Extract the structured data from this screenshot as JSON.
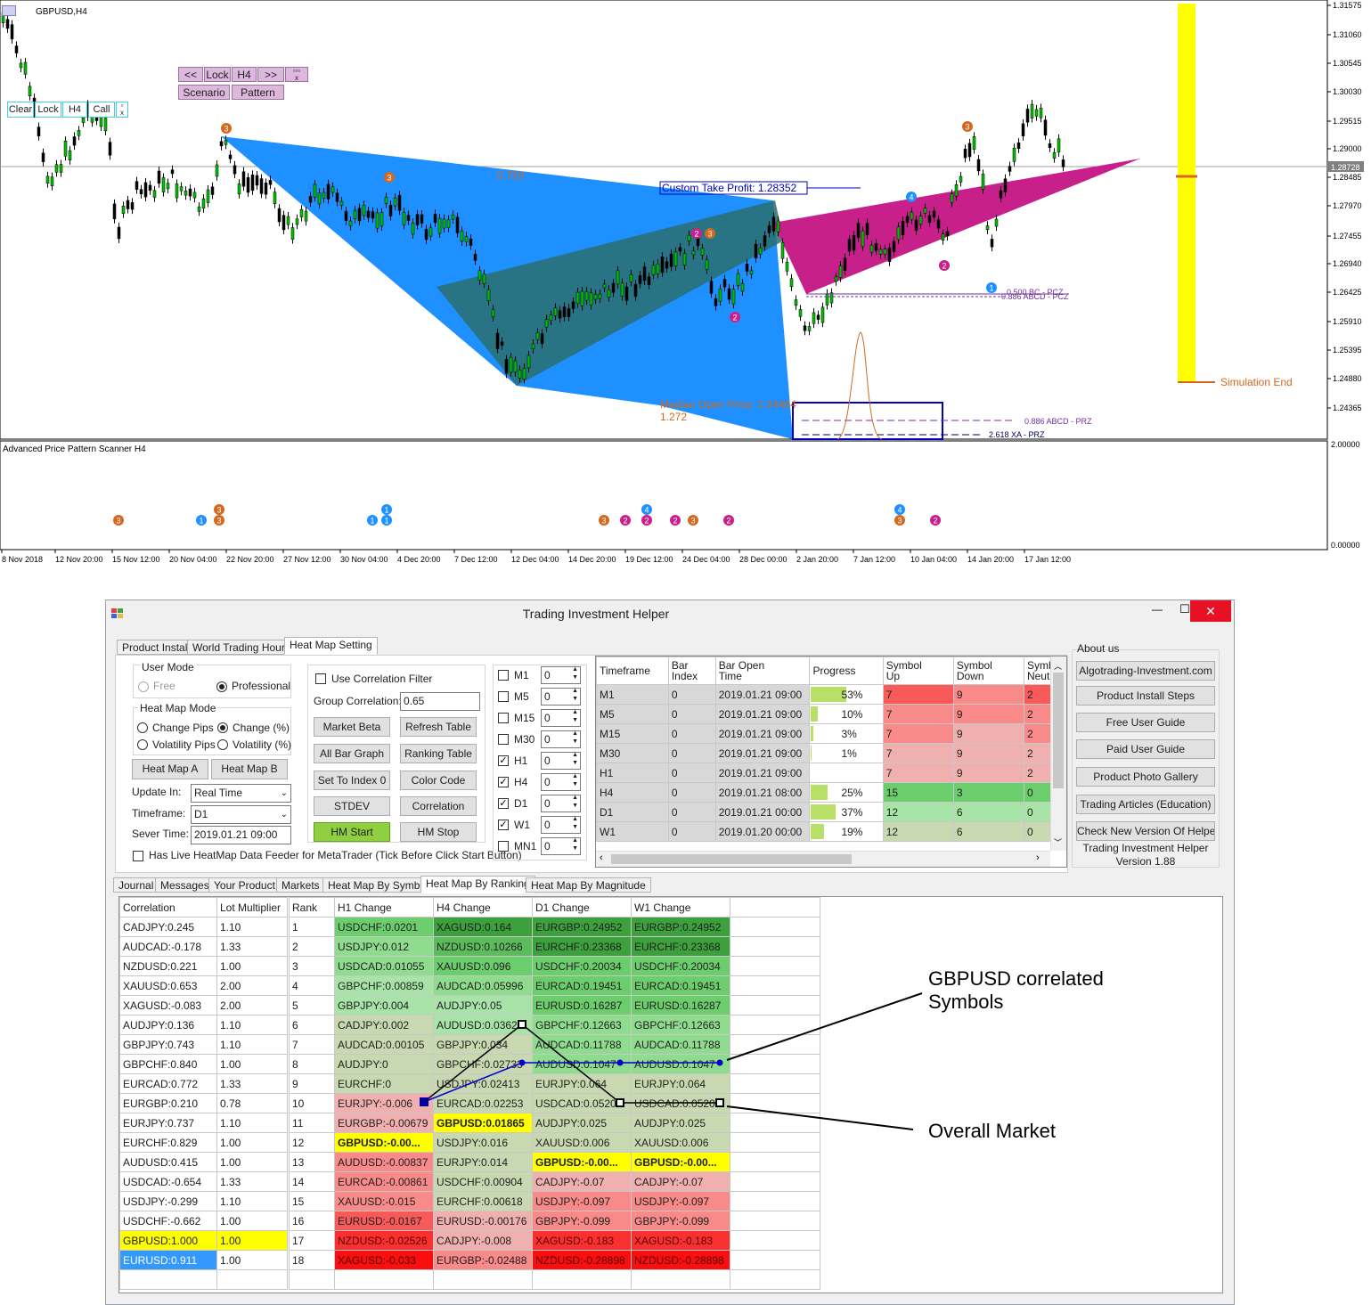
{
  "chart": {
    "symbol_title": "GBPUSD,H4",
    "indicator_title": "Advanced Price Pattern Scanner H4",
    "price_labels": [
      "1.31575",
      "1.31060",
      "1.30545",
      "1.30030",
      "1.29515",
      "1.29000",
      "1.28728",
      "1.28485",
      "1.27970",
      "1.27455",
      "1.26940",
      "1.26425",
      "1.25910",
      "1.25395",
      "1.24880",
      "1.24365"
    ],
    "current_price": "1.28728",
    "indicator_scale": [
      "2.00000",
      "0.00000"
    ],
    "date_labels": [
      "8 Nov 2018",
      "12 Nov 20:00",
      "15 Nov 12:00",
      "20 Nov 04:00",
      "22 Nov 20:00",
      "27 Nov 12:00",
      "30 Nov 04:00",
      "4 Dec 20:00",
      "7 Dec 12:00",
      "12 Dec 04:00",
      "14 Dec 20:00",
      "19 Dec 12:00",
      "24 Dec 04:00",
      "28 Dec 00:00",
      "2 Jan 20:00",
      "7 Jan 12:00",
      "10 Jan 04:00",
      "14 Jan 20:00",
      "17 Jan 12:00"
    ],
    "annotations": {
      "ratio_top": "0.750",
      "custom_tp": "Custom Take Profit: 1.28352",
      "median_open": "Median Open Price: 1.24404",
      "ratio_bottom": "1.272",
      "prz_1": "0.500 BC - PCZ",
      "prz_1b": "0.886 ABCD - PCZ",
      "prz_2": "0.886 ABCD - PRZ",
      "prz_3": "2.618 XA - PRZ",
      "simulation_end": "Simulation End"
    },
    "toolbar1": {
      "prev": "<<",
      "lock": "Lock",
      "tf": "H4",
      "next": ">>",
      "scenario": "Scenario",
      "pattern": "Pattern"
    },
    "toolbar2": {
      "clear": "Clear",
      "lock": "Lock",
      "tf": "H4",
      "call": "Call"
    },
    "colors": {
      "bull_harmonic": "#1e90ff",
      "bear_harmonic": "#c8208a",
      "teal_overlap": "#2a7f7f",
      "simulation_bar": "#ffff00",
      "orange_marker": "#d2691e"
    }
  },
  "window": {
    "title": "Trading Investment Helper",
    "min_glyph": "—",
    "max_glyph": "☐",
    "close_glyph": "✕",
    "top_tabs": [
      "Product Install",
      "World Trading Hours",
      "Heat Map Setting"
    ],
    "user_mode": {
      "title": "User Mode",
      "free": "Free",
      "professional": "Professional"
    },
    "heat_map_mode": {
      "title": "Heat Map Mode",
      "change_pips": "Change Pips",
      "change_pct": "Change (%)",
      "vol_pips": "Volatility Pips",
      "vol_pct": "Volatility (%)"
    },
    "buttons_left": {
      "heat_map_a": "Heat Map A",
      "heat_map_b": "Heat Map B"
    },
    "update_in": {
      "label": "Update In:",
      "value": "Real Time"
    },
    "timeframe": {
      "label": "Timeframe:",
      "value": "D1"
    },
    "server_time": {
      "label": "Sever Time:",
      "value": "2019.01.21 09:00"
    },
    "live_feeder": "Has Live HeatMap Data Feeder for MetaTrader (Tick Before Click Start Button)",
    "correlation": {
      "filter_label": "Use Correlation Filter",
      "group_label": "Group Correlation:",
      "group_value": "0.65"
    },
    "mid_buttons": [
      "Market Beta",
      "Refresh Table",
      "All Bar Graph",
      "Ranking Table",
      "Set To Index 0",
      "Color Code",
      "STDEV",
      "Correlation",
      "HM Start",
      "HM Stop"
    ],
    "timeframes": [
      {
        "name": "M1",
        "checked": false,
        "value": "0"
      },
      {
        "name": "M5",
        "checked": false,
        "value": "0"
      },
      {
        "name": "M15",
        "checked": false,
        "value": "0"
      },
      {
        "name": "M30",
        "checked": false,
        "value": "0"
      },
      {
        "name": "H1",
        "checked": true,
        "value": "0"
      },
      {
        "name": "H4",
        "checked": true,
        "value": "0"
      },
      {
        "name": "D1",
        "checked": true,
        "value": "0"
      },
      {
        "name": "W1",
        "checked": true,
        "value": "0"
      },
      {
        "name": "MN1",
        "checked": false,
        "value": "0"
      }
    ],
    "tf_table": {
      "headers": [
        "Timeframe",
        "Bar\nIndex",
        "Bar Open\nTime",
        "Progress",
        "Symbol\nUp",
        "Symbol\nDown",
        "Symbol\nNeutral"
      ],
      "rows": [
        {
          "tf": "M1",
          "idx": "0",
          "time": "2019.01.21 09:00",
          "progress": "53%",
          "up": "7",
          "down": "9",
          "neutral": "2"
        },
        {
          "tf": "M5",
          "idx": "0",
          "time": "2019.01.21 09:00",
          "progress": "10%",
          "up": "7",
          "down": "9",
          "neutral": "2"
        },
        {
          "tf": "M15",
          "idx": "0",
          "time": "2019.01.21 09:00",
          "progress": "3%",
          "up": "7",
          "down": "9",
          "neutral": "2"
        },
        {
          "tf": "M30",
          "idx": "0",
          "time": "2019.01.21 09:00",
          "progress": "1%",
          "up": "7",
          "down": "9",
          "neutral": "2"
        },
        {
          "tf": "H1",
          "idx": "0",
          "time": "2019.01.21 09:00",
          "progress": "",
          "up": "7",
          "down": "9",
          "neutral": "2"
        },
        {
          "tf": "H4",
          "idx": "0",
          "time": "2019.01.21 08:00",
          "progress": "25%",
          "up": "15",
          "down": "3",
          "neutral": "0"
        },
        {
          "tf": "D1",
          "idx": "0",
          "time": "2019.01.21 00:00",
          "progress": "37%",
          "up": "12",
          "down": "6",
          "neutral": "0"
        },
        {
          "tf": "W1",
          "idx": "0",
          "time": "2019.01.20 00:00",
          "progress": "19%",
          "up": "12",
          "down": "6",
          "neutral": "0"
        }
      ]
    },
    "about": {
      "title": "About us",
      "buttons": [
        "Algotrading-Investment.com",
        "Product Install Steps",
        "Free User Guide",
        "Paid User Guide",
        "Product Photo Gallery",
        "Trading Articles (Education)",
        "Check New Version Of Helper"
      ],
      "product": "Trading Investment Helper",
      "version": "Version 1.88"
    },
    "bottom_tabs": [
      "Journal",
      "Messages",
      "Your Product",
      "Markets",
      "Heat Map By Symbol",
      "Heat Map By Ranking",
      "Heat Map By Magnitude"
    ],
    "corr_table": {
      "headers": [
        "Correlation",
        "Lot Multiplier"
      ],
      "rows": [
        [
          "CADJPY:0.245",
          "1.10"
        ],
        [
          "AUDCAD:-0.178",
          "1.33"
        ],
        [
          "NZDUSD:0.221",
          "1.00"
        ],
        [
          "XAUUSD:0.653",
          "2.00"
        ],
        [
          "XAGUSD:-0.083",
          "2.00"
        ],
        [
          "AUDJPY:0.136",
          "1.10"
        ],
        [
          "GBPJPY:0.743",
          "1.10"
        ],
        [
          "GBPCHF:0.840",
          "1.00"
        ],
        [
          "EURCAD:0.772",
          "1.33"
        ],
        [
          "EURGBP:0.210",
          "0.78"
        ],
        [
          "EURJPY:0.737",
          "1.10"
        ],
        [
          "EURCHF:0.829",
          "1.00"
        ],
        [
          "AUDUSD:0.415",
          "1.00"
        ],
        [
          "USDCAD:-0.654",
          "1.33"
        ],
        [
          "USDJPY:-0.299",
          "1.10"
        ],
        [
          "USDCHF:-0.662",
          "1.00"
        ],
        [
          "GBPUSD:1.000",
          "1.00"
        ],
        [
          "EURUSD:0.911",
          "1.00"
        ]
      ]
    },
    "rank_table": {
      "headers": [
        "Rank",
        "H1 Change",
        "H4 Change",
        "D1 Change",
        "W1 Change"
      ],
      "rows": [
        [
          "1",
          "USDCHF:0.0201",
          "XAGUSD:0.164",
          "EURGBP:0.24952",
          "EURGBP:0.24952"
        ],
        [
          "2",
          "USDJPY:0.012",
          "NZDUSD:0.10266",
          "EURCHF:0.23368",
          "EURCHF:0.23368"
        ],
        [
          "3",
          "USDCAD:0.01055",
          "XAUUSD:0.096",
          "USDCHF:0.20034",
          "USDCHF:0.20034"
        ],
        [
          "4",
          "GBPCHF:0.00859",
          "AUDCAD:0.05996",
          "EURCAD:0.19451",
          "EURCAD:0.19451"
        ],
        [
          "5",
          "GBPJPY:0.004",
          "AUDJPY:0.05",
          "EURUSD:0.16287",
          "EURUSD:0.16287"
        ],
        [
          "6",
          "CADJPY:0.002",
          "AUDUSD:0.03627",
          "GBPCHF:0.12663",
          "GBPCHF:0.12663"
        ],
        [
          "7",
          "AUDCAD:0.00105",
          "GBPJPY:0.034",
          "AUDCAD:0.11788",
          "AUDCAD:0.11788"
        ],
        [
          "8",
          "AUDJPY:0",
          "GBPCHF:0.02733",
          "AUDUSD:0.1047",
          "AUDUSD:0.1047"
        ],
        [
          "9",
          "EURCHF:0",
          "USDJPY:0.02413",
          "EURJPY:0.064",
          "EURJPY:0.064"
        ],
        [
          "10",
          "EURJPY:-0.006",
          "EURCAD:0.02253",
          "USDCAD:0.05204",
          "USDCAD:0.05204"
        ],
        [
          "11",
          "EURGBP:-0.00679",
          "GBPUSD:0.01865",
          "AUDJPY:0.025",
          "AUDJPY:0.025"
        ],
        [
          "12",
          "GBPUSD:-0.00...",
          "USDJPY:0.016",
          "XAUUSD:0.006",
          "XAUUSD:0.006"
        ],
        [
          "13",
          "AUDUSD:-0.00837",
          "EURJPY:0.014",
          "GBPUSD:-0.00...",
          "GBPUSD:-0.00..."
        ],
        [
          "14",
          "EURCAD:-0.00861",
          "USDCHF:0.00904",
          "CADJPY:-0.07",
          "CADJPY:-0.07"
        ],
        [
          "15",
          "XAUUSD:-0.015",
          "EURCHF:0.00618",
          "USDJPY:-0.097",
          "USDJPY:-0.097"
        ],
        [
          "16",
          "EURUSD:-0.0167",
          "EURUSD:-0.00176",
          "GBPJPY:-0.099",
          "GBPJPY:-0.099"
        ],
        [
          "17",
          "NZDUSD:-0.02526",
          "CADJPY:-0.008",
          "XAGUSD:-0.183",
          "XAGUSD:-0.183"
        ],
        [
          "18",
          "XAGUSD:-0.033",
          "EURGBP:-0.02488",
          "NZDUSD:-0.28898",
          "NZDUSD:-0.28898"
        ]
      ]
    }
  },
  "callouts": {
    "correlated": "GBPUSD correlated\nSymbols",
    "overall": "Overall Market"
  }
}
